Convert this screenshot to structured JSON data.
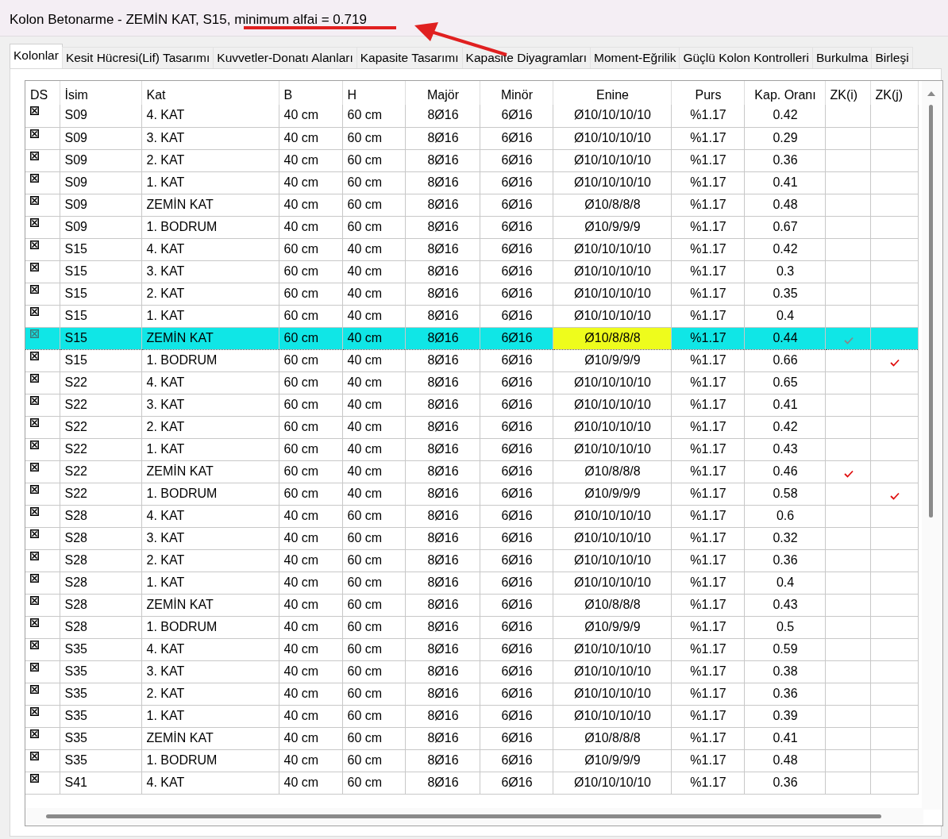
{
  "window": {
    "title": "Kolon Betonarme - ZEMİN KAT, S15, minimum alfai = 0.719"
  },
  "tabs": [
    {
      "label": "Kolonlar",
      "selected": true
    },
    {
      "label": "Kesit Hücresi(Lif) Tasarımı",
      "selected": false
    },
    {
      "label": "Kuvvetler-Donatı Alanları",
      "selected": false
    },
    {
      "label": "Kapasite Tasarımı",
      "selected": false
    },
    {
      "label": "Kapasite Diyagramları",
      "selected": false
    },
    {
      "label": "Moment-Eğrilik",
      "selected": false
    },
    {
      "label": "Güçlü Kolon Kontrolleri",
      "selected": false
    },
    {
      "label": "Burkulma",
      "selected": false
    },
    {
      "label": "Birleşi",
      "selected": false
    }
  ],
  "table": {
    "columns": [
      {
        "label": "DS",
        "kind": "check"
      },
      {
        "label": "İsim",
        "kind": "text"
      },
      {
        "label": "Kat",
        "kind": "text"
      },
      {
        "label": "B",
        "kind": "text"
      },
      {
        "label": "H",
        "kind": "text"
      },
      {
        "label": "Majör",
        "kind": "text"
      },
      {
        "label": "Minör",
        "kind": "text"
      },
      {
        "label": "Enine",
        "kind": "text"
      },
      {
        "label": "Purs",
        "kind": "text"
      },
      {
        "label": "Kap. Oranı",
        "kind": "text"
      },
      {
        "label": "ZK(i)",
        "kind": "tick"
      },
      {
        "label": "ZK(j)",
        "kind": "tick"
      }
    ],
    "rows": [
      {
        "cells": [
          true,
          "S09",
          "4. KAT",
          "40 cm",
          "60 cm",
          "8Ø16",
          "6Ø16",
          "Ø10/10/10/10",
          "%1.17",
          "0.42",
          false,
          false
        ],
        "selected": false
      },
      {
        "cells": [
          true,
          "S09",
          "3. KAT",
          "40 cm",
          "60 cm",
          "8Ø16",
          "6Ø16",
          "Ø10/10/10/10",
          "%1.17",
          "0.29",
          false,
          false
        ],
        "selected": false
      },
      {
        "cells": [
          true,
          "S09",
          "2. KAT",
          "40 cm",
          "60 cm",
          "8Ø16",
          "6Ø16",
          "Ø10/10/10/10",
          "%1.17",
          "0.36",
          false,
          false
        ],
        "selected": false
      },
      {
        "cells": [
          true,
          "S09",
          "1. KAT",
          "40 cm",
          "60 cm",
          "8Ø16",
          "6Ø16",
          "Ø10/10/10/10",
          "%1.17",
          "0.41",
          false,
          false
        ],
        "selected": false
      },
      {
        "cells": [
          true,
          "S09",
          "ZEMİN KAT",
          "40 cm",
          "60 cm",
          "8Ø16",
          "6Ø16",
          "Ø10/8/8/8",
          "%1.17",
          "0.48",
          false,
          false
        ],
        "selected": false
      },
      {
        "cells": [
          true,
          "S09",
          "1. BODRUM",
          "40 cm",
          "60 cm",
          "8Ø16",
          "6Ø16",
          "Ø10/9/9/9",
          "%1.17",
          "0.67",
          false,
          false
        ],
        "selected": false
      },
      {
        "cells": [
          true,
          "S15",
          "4. KAT",
          "60 cm",
          "40 cm",
          "8Ø16",
          "6Ø16",
          "Ø10/10/10/10",
          "%1.17",
          "0.42",
          false,
          false
        ],
        "selected": false
      },
      {
        "cells": [
          true,
          "S15",
          "3. KAT",
          "60 cm",
          "40 cm",
          "8Ø16",
          "6Ø16",
          "Ø10/10/10/10",
          "%1.17",
          "0.3",
          false,
          false
        ],
        "selected": false
      },
      {
        "cells": [
          true,
          "S15",
          "2. KAT",
          "60 cm",
          "40 cm",
          "8Ø16",
          "6Ø16",
          "Ø10/10/10/10",
          "%1.17",
          "0.35",
          false,
          false
        ],
        "selected": false
      },
      {
        "cells": [
          true,
          "S15",
          "1. KAT",
          "60 cm",
          "40 cm",
          "8Ø16",
          "6Ø16",
          "Ø10/10/10/10",
          "%1.17",
          "0.4",
          false,
          false
        ],
        "selected": false
      },
      {
        "cells": [
          true,
          "S15",
          "ZEMİN KAT",
          "60 cm",
          "40 cm",
          "8Ø16",
          "6Ø16",
          "Ø10/8/8/8",
          "%1.17",
          "0.44",
          true,
          false
        ],
        "selected": true,
        "focus": [
          false,
          false,
          false,
          false,
          false,
          false,
          false,
          true,
          false,
          false,
          false,
          false
        ]
      },
      {
        "cells": [
          true,
          "S15",
          "1. BODRUM",
          "60 cm",
          "40 cm",
          "8Ø16",
          "6Ø16",
          "Ø10/9/9/9",
          "%1.17",
          "0.66",
          false,
          true
        ],
        "selected": false
      },
      {
        "cells": [
          true,
          "S22",
          "4. KAT",
          "60 cm",
          "40 cm",
          "8Ø16",
          "6Ø16",
          "Ø10/10/10/10",
          "%1.17",
          "0.65",
          false,
          false
        ],
        "selected": false
      },
      {
        "cells": [
          true,
          "S22",
          "3. KAT",
          "60 cm",
          "40 cm",
          "8Ø16",
          "6Ø16",
          "Ø10/10/10/10",
          "%1.17",
          "0.41",
          false,
          false
        ],
        "selected": false
      },
      {
        "cells": [
          true,
          "S22",
          "2. KAT",
          "60 cm",
          "40 cm",
          "8Ø16",
          "6Ø16",
          "Ø10/10/10/10",
          "%1.17",
          "0.42",
          false,
          false
        ],
        "selected": false
      },
      {
        "cells": [
          true,
          "S22",
          "1. KAT",
          "60 cm",
          "40 cm",
          "8Ø16",
          "6Ø16",
          "Ø10/10/10/10",
          "%1.17",
          "0.43",
          false,
          false
        ],
        "selected": false
      },
      {
        "cells": [
          true,
          "S22",
          "ZEMİN KAT",
          "60 cm",
          "40 cm",
          "8Ø16",
          "6Ø16",
          "Ø10/8/8/8",
          "%1.17",
          "0.46",
          true,
          false
        ],
        "selected": false
      },
      {
        "cells": [
          true,
          "S22",
          "1. BODRUM",
          "60 cm",
          "40 cm",
          "8Ø16",
          "6Ø16",
          "Ø10/9/9/9",
          "%1.17",
          "0.58",
          false,
          true
        ],
        "selected": false
      },
      {
        "cells": [
          true,
          "S28",
          "4. KAT",
          "40 cm",
          "60 cm",
          "8Ø16",
          "6Ø16",
          "Ø10/10/10/10",
          "%1.17",
          "0.6",
          false,
          false
        ],
        "selected": false
      },
      {
        "cells": [
          true,
          "S28",
          "3. KAT",
          "40 cm",
          "60 cm",
          "8Ø16",
          "6Ø16",
          "Ø10/10/10/10",
          "%1.17",
          "0.32",
          false,
          false
        ],
        "selected": false
      },
      {
        "cells": [
          true,
          "S28",
          "2. KAT",
          "40 cm",
          "60 cm",
          "8Ø16",
          "6Ø16",
          "Ø10/10/10/10",
          "%1.17",
          "0.36",
          false,
          false
        ],
        "selected": false
      },
      {
        "cells": [
          true,
          "S28",
          "1. KAT",
          "40 cm",
          "60 cm",
          "8Ø16",
          "6Ø16",
          "Ø10/10/10/10",
          "%1.17",
          "0.4",
          false,
          false
        ],
        "selected": false
      },
      {
        "cells": [
          true,
          "S28",
          "ZEMİN KAT",
          "40 cm",
          "60 cm",
          "8Ø16",
          "6Ø16",
          "Ø10/8/8/8",
          "%1.17",
          "0.43",
          false,
          false
        ],
        "selected": false
      },
      {
        "cells": [
          true,
          "S28",
          "1. BODRUM",
          "40 cm",
          "60 cm",
          "8Ø16",
          "6Ø16",
          "Ø10/9/9/9",
          "%1.17",
          "0.5",
          false,
          false
        ],
        "selected": false
      },
      {
        "cells": [
          true,
          "S35",
          "4. KAT",
          "40 cm",
          "60 cm",
          "8Ø16",
          "6Ø16",
          "Ø10/10/10/10",
          "%1.17",
          "0.59",
          false,
          false
        ],
        "selected": false
      },
      {
        "cells": [
          true,
          "S35",
          "3. KAT",
          "40 cm",
          "60 cm",
          "8Ø16",
          "6Ø16",
          "Ø10/10/10/10",
          "%1.17",
          "0.38",
          false,
          false
        ],
        "selected": false
      },
      {
        "cells": [
          true,
          "S35",
          "2. KAT",
          "40 cm",
          "60 cm",
          "8Ø16",
          "6Ø16",
          "Ø10/10/10/10",
          "%1.17",
          "0.36",
          false,
          false
        ],
        "selected": false
      },
      {
        "cells": [
          true,
          "S35",
          "1. KAT",
          "40 cm",
          "60 cm",
          "8Ø16",
          "6Ø16",
          "Ø10/10/10/10",
          "%1.17",
          "0.39",
          false,
          false
        ],
        "selected": false
      },
      {
        "cells": [
          true,
          "S35",
          "ZEMİN KAT",
          "40 cm",
          "60 cm",
          "8Ø16",
          "6Ø16",
          "Ø10/8/8/8",
          "%1.17",
          "0.41",
          false,
          false
        ],
        "selected": false
      },
      {
        "cells": [
          true,
          "S35",
          "1. BODRUM",
          "40 cm",
          "60 cm",
          "8Ø16",
          "6Ø16",
          "Ø10/9/9/9",
          "%1.17",
          "0.48",
          false,
          false
        ],
        "selected": false
      },
      {
        "cells": [
          true,
          "S41",
          "4. KAT",
          "40 cm",
          "60 cm",
          "8Ø16",
          "6Ø16",
          "Ø10/10/10/10",
          "%1.17",
          "0.36",
          false,
          false
        ],
        "selected": false
      }
    ]
  }
}
